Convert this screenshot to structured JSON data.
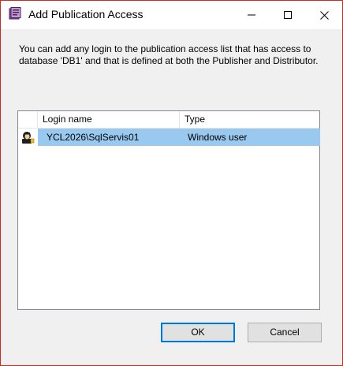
{
  "window": {
    "title": "Add Publication Access"
  },
  "description": "You can add any login to the publication access list that has access to database 'DB1' and that is defined at both the Publisher and Distributor.",
  "list": {
    "columns": [
      "Login name",
      "Type"
    ],
    "rows": [
      {
        "login": "YCL2026\\SqlServis01",
        "type": "Windows user",
        "selected": true
      }
    ]
  },
  "buttons": {
    "ok": "OK",
    "cancel": "Cancel"
  },
  "colors": {
    "selection": "#99c9ef",
    "focus_border": "#0078d7",
    "window_border": "#e2231a"
  },
  "icons": {
    "app": "publication-app-icon",
    "row": "user-login-icon"
  }
}
